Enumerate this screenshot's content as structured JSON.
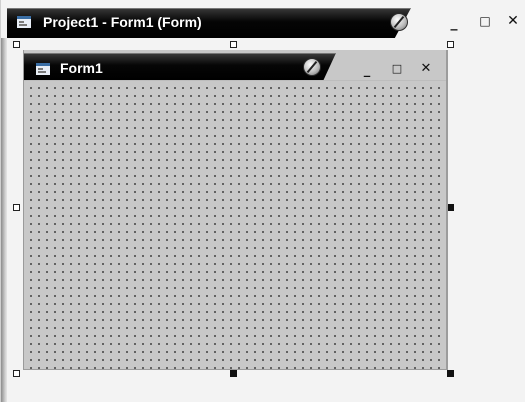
{
  "outer_window": {
    "title": "Project1 - Form1 (Form)",
    "minimize_glyph": "_",
    "maximize_glyph": "□",
    "close_glyph": "✕",
    "icons": {
      "app": "form-app-icon",
      "badge": "slashed-circle-icon"
    }
  },
  "form_window": {
    "title": "Form1",
    "minimize_glyph": "_",
    "maximize_glyph": "□",
    "close_glyph": "✕",
    "icons": {
      "app": "form-app-icon",
      "badge": "slashed-circle-icon"
    }
  },
  "colors": {
    "titlebar": "#000000",
    "form_background": "#c8c8c8",
    "designer_background": "#f3f3f3",
    "grid_dot": "#222222"
  },
  "design_grid": {
    "visible": true
  },
  "selection_handles": [
    {
      "name": "top-left",
      "style": "hollow"
    },
    {
      "name": "top-center",
      "style": "hollow"
    },
    {
      "name": "top-right",
      "style": "hollow"
    },
    {
      "name": "middle-left",
      "style": "hollow"
    },
    {
      "name": "middle-right",
      "style": "filled"
    },
    {
      "name": "bottom-left",
      "style": "hollow"
    },
    {
      "name": "bottom-center",
      "style": "filled"
    },
    {
      "name": "bottom-right",
      "style": "filled"
    }
  ]
}
